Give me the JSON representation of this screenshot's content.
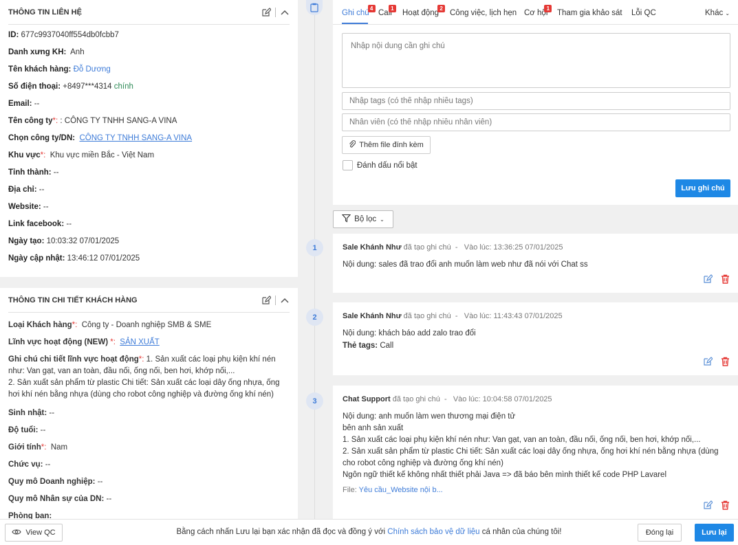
{
  "contact": {
    "title": "THÔNG TIN LIÊN HỆ",
    "id_label": "ID:",
    "id_value": "677c9937040ff554db0fcbb7",
    "salutation_label": "Danh xưng KH:",
    "salutation_value": "Anh",
    "name_label": "Tên khách hàng:",
    "name_value": "Đỗ Dương",
    "phone_label": "Số điện thoại:",
    "phone_value": "+8497***4314",
    "phone_tag": "chính",
    "email_label": "Email:",
    "email_value": "--",
    "company_label": "Tên công ty",
    "company_value": ": CÔNG TY TNHH SANG-A VINA",
    "choose_company_label": "Chọn công ty/DN:",
    "choose_company_value": "CÔNG TY TNHH SANG-A VINA",
    "region_label": "Khu vực",
    "region_value": "Khu vực miền Bắc - Việt Nam",
    "province_label": "Tỉnh thành:",
    "province_value": "--",
    "address_label": "Địa chỉ:",
    "address_value": "--",
    "website_label": "Website:",
    "website_value": "--",
    "facebook_label": "Link facebook:",
    "facebook_value": "--",
    "created_label": "Ngày tạo:",
    "created_value": "10:03:32 07/01/2025",
    "updated_label": "Ngày cập nhật:",
    "updated_value": "13:46:12 07/01/2025"
  },
  "detail": {
    "title": "THÔNG TIN CHI TIẾT KHÁCH HÀNG",
    "type_label": "Loại Khách hàng",
    "type_value": "Công ty - Doanh nghiệp SMB & SME",
    "field_label": "Lĩnh vực hoạt động (NEW)",
    "field_value": "SẢN XUẤT",
    "field_note_label": "Ghi chú chi tiết lĩnh vực hoạt động",
    "field_note_value1": "1. Sản xuất các loại phụ kiện khí nén như: Van gạt, van an toàn, đầu nối, ống nối, ben hơi, khớp nối,...",
    "field_note_value2": "2. Sản xuất sản phẩm từ plastic Chi tiết: Sản xuất các loại dây ống nhựa, ống hơi khí nén bằng nhựa (dùng cho robot công nghiệp và đường ống khí nén)",
    "birthday_label": "Sinh nhật:",
    "birthday_value": "--",
    "age_label": "Độ tuổi:",
    "age_value": "--",
    "gender_label": "Giới tính",
    "gender_value": "Nam",
    "position_label": "Chức vụ:",
    "position_value": "--",
    "biz_size_label": "Quy mô Doanh nghiệp:",
    "biz_size_value": "--",
    "staff_size_label": "Quy mô Nhân sự của DN:",
    "staff_size_value": "--",
    "dept_label": "Phòng ban:"
  },
  "tabs": [
    {
      "label": "Ghi chú",
      "badge": "4"
    },
    {
      "label": "Call",
      "badge": "1"
    },
    {
      "label": "Hoạt động",
      "badge": "2"
    },
    {
      "label": "Công việc, lịch hẹn",
      "badge": ""
    },
    {
      "label": "Cơ hội",
      "badge": "1"
    },
    {
      "label": "Tham gia khảo sát",
      "badge": ""
    },
    {
      "label": "Lỗi QC",
      "badge": ""
    },
    {
      "label": "Khác",
      "badge": ""
    }
  ],
  "editor": {
    "note_placeholder": "Nhập nội dung cần ghi chú",
    "tags_placeholder": "Nhập tags (có thể nhập nhiều tags)",
    "staff_placeholder": "Nhân viên (có thể nhập nhiều nhân viên)",
    "attach_label": "Thêm file đính kèm",
    "highlight_label": "Đánh dấu nổi bật",
    "save_label": "Lưu ghi chú"
  },
  "filter_label": "Bộ lọc",
  "entries": [
    {
      "num": "1",
      "author": "Sale Khánh Như",
      "action": "đã tạo ghi chú",
      "time": "Vào lúc: 13:36:25 07/01/2025",
      "content_label": "Nội dung:",
      "content": "sales đã trao đổi anh muốn làm web như đã nói với Chat ss"
    },
    {
      "num": "2",
      "author": "Sale Khánh Như",
      "action": "đã tạo ghi chú",
      "time": "Vào lúc: 11:43:43 07/01/2025",
      "content_label": "Nội dung:",
      "content": "khách báo add zalo trao đổi",
      "tags_label": "Thẻ tags:",
      "tags": "Call"
    },
    {
      "num": "3",
      "author": "Chat Support",
      "action": "đã tạo ghi chú",
      "time": "Vào lúc: 10:04:58 07/01/2025",
      "content_label": "Nội dung:",
      "content": "anh muốn làm wen thương mại điện tử",
      "lines": [
        "bên anh sản xuất",
        "1. Sản xuất các loại phụ kiện khí nén như: Van gạt, van an toàn, đầu nối, ống nối, ben hơi, khớp nối,...",
        "2. Sản xuất sản phẩm từ plastic Chi tiết: Sản xuất các loại dây ống nhựa, ống hơi khí nén bằng nhựa (dùng cho robot công nghiệp và đường ống khí nén)",
        "Ngôn ngữ thiết kế không nhất thiết phải Java => đã báo bên mình thiết kế code PHP Lavarel"
      ],
      "file_label": "File:",
      "file_name": "Yêu cầu_Website nội b..."
    }
  ],
  "footer": {
    "view_qc": "View QC",
    "consent_pre": "Bằng cách nhấn Lưu lại bạn xác nhận đã đọc và đồng ý với ",
    "consent_link": "Chính sách bảo vệ dữ liệu",
    "consent_post": " cá nhân của chúng tôi!",
    "close": "Đóng lại",
    "save": "Lưu lại"
  },
  "colors": {
    "accent": "#1e88e5",
    "link": "#3d7bd8",
    "required": "#e53935",
    "badge": "#e53935",
    "delete": "#e53935"
  }
}
